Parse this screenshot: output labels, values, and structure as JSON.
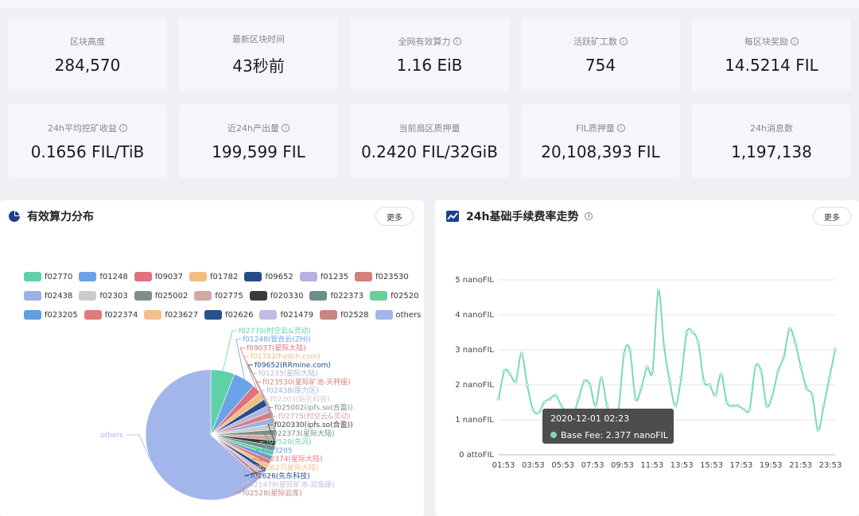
{
  "stats_row1": [
    {
      "label": "区块高度",
      "value": "284,570",
      "info": false
    },
    {
      "label": "最新区块时间",
      "value": "43秒前",
      "info": false
    },
    {
      "label": "全网有效算力",
      "value": "1.16 EiB",
      "info": true
    },
    {
      "label": "活跃矿工数",
      "value": "754",
      "info": true
    },
    {
      "label": "每区块奖励",
      "value": "14.5214 FIL",
      "info": true
    }
  ],
  "stats_row2": [
    {
      "label": "24h平均挖矿收益",
      "value": "0.1656 FIL/TiB",
      "info": true
    },
    {
      "label": "近24h产出量",
      "value": "199,599 FIL",
      "info": true
    },
    {
      "label": "当前扇区质押量",
      "value": "0.2420 FIL/32GiB",
      "info": false
    },
    {
      "label": "FIL质押量",
      "value": "20,108,393 FIL",
      "info": true
    },
    {
      "label": "24h消息数",
      "value": "1,197,138",
      "info": false
    }
  ],
  "power_panel": {
    "title": "有效算力分布",
    "more_label": "更多"
  },
  "fee_panel": {
    "title": "24h基础手续费率走势",
    "more_label": "更多",
    "tooltip_time": "2020-12-01 02:23",
    "tooltip_text": "Base Fee: 2.377 nanoFIL"
  },
  "colors": {
    "fee_line": "#7ad8bd",
    "tooltip_bg": "#4d4d4d",
    "others_slice": "#a2b6ec"
  },
  "chart_data": [
    {
      "type": "pie",
      "title": "有效算力分布",
      "legend": [
        "f02770",
        "f01248",
        "f09037",
        "f01782",
        "f09652",
        "f01235",
        "f023530",
        "f02438",
        "f02303",
        "f025002",
        "f02775",
        "f020330",
        "f022373",
        "f02520",
        "f023205",
        "f022374",
        "f023627",
        "f02626",
        "f021479",
        "f02528",
        "others"
      ],
      "slice_colors": [
        "#5ed1a8",
        "#6aa3e8",
        "#e0727e",
        "#f1bd81",
        "#254d8c",
        "#b6b1e1",
        "#d5807b",
        "#9dafe6",
        "#c9ccc9",
        "#7f8e86",
        "#d4a7a7",
        "#3d3a3a",
        "#6e8e8a",
        "#67cf9a",
        "#5e9fe0",
        "#e07b7b",
        "#f3c08c",
        "#27508f",
        "#c1bbe7",
        "#c98582",
        "#a2b6ec"
      ],
      "slice_labels": [
        "f02770(时空云&灵动)",
        "f01248(智合云(ZH))",
        "f09037(星际大陆)",
        "f01782(heilch.com)",
        "f09652(RRmine.com)",
        "f01235(星际大陆)",
        "f023530(星际矿池-天秤座)",
        "f02438(原力区)",
        "f02303(矩先科技)",
        "f025002(ipfs.so(合盈))",
        "f02775(时空云&灵动)",
        "f020330(ipfs.so(合盈))",
        "f022373(星际大陆)",
        "f02520(先河)",
        "f023205",
        "f022374(星际大陆)",
        "f023627(星际大陆)",
        "f02626(先东科技)",
        "f021479(星际矿池-双鱼座)",
        "f02528(星际云库)",
        "others"
      ],
      "values": [
        6.0,
        5.5,
        2.3,
        2.0,
        1.8,
        1.7,
        1.6,
        1.5,
        1.5,
        1.4,
        1.4,
        1.3,
        1.3,
        1.2,
        1.2,
        1.1,
        1.1,
        1.1,
        1.0,
        1.0,
        64.0
      ]
    },
    {
      "type": "line",
      "title": "24h基础手续费率走势",
      "y_unit": "nanoFIL",
      "y_ticks": [
        "0 attoFIL",
        "1 nanoFIL",
        "2 nanoFIL",
        "3 nanoFIL",
        "4 nanoFIL",
        "5 nanoFIL"
      ],
      "ylim": [
        0,
        5
      ],
      "x_ticks": [
        "01:53",
        "03:53",
        "05:53",
        "07:53",
        "09:53",
        "11:53",
        "13:53",
        "15:53",
        "17:53",
        "19:53",
        "21:53",
        "23:53"
      ],
      "series": [
        {
          "values": [
            1.6,
            2.4,
            2.3,
            2.1,
            2.9,
            2.0,
            1.3,
            1.2,
            1.5,
            1.6,
            1.7,
            1.4,
            1.2,
            1.1,
            1.6,
            2.1,
            2.0,
            1.4,
            2.2,
            1.4,
            1.1,
            1.3,
            2.9,
            3.0,
            1.6,
            1.9,
            2.5,
            2.4,
            4.7,
            3.1,
            2.1,
            1.4,
            2.2,
            3.5,
            3.5,
            3.2,
            2.1,
            2.0,
            1.7,
            2.3,
            1.5,
            1.4,
            1.4,
            1.3,
            1.3,
            2.5,
            2.4,
            1.4,
            1.7,
            2.4,
            2.8,
            3.6,
            3.2,
            2.5,
            1.9,
            1.7,
            0.7,
            1.4,
            2.2,
            3.0
          ]
        }
      ]
    }
  ]
}
